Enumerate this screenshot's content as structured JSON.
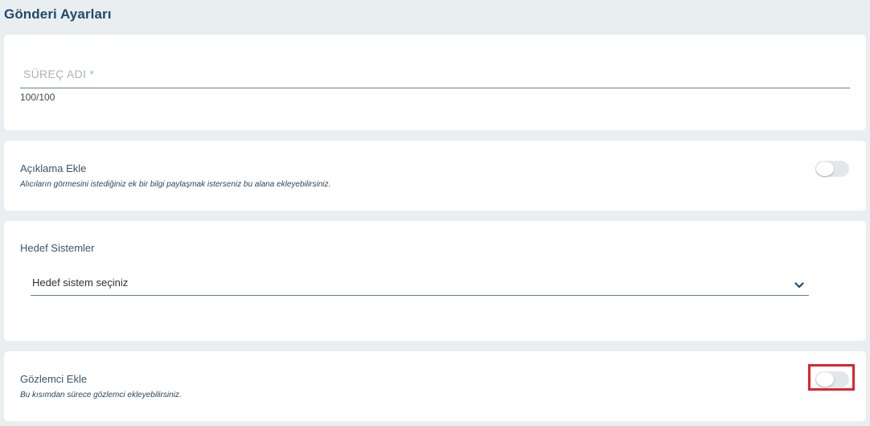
{
  "page": {
    "title": "Gönderi Ayarları"
  },
  "process_name": {
    "placeholder": "SÜREÇ ADI *",
    "value": "",
    "counter": "100/100"
  },
  "description": {
    "label": "Açıklama Ekle",
    "help": "Alıcıların görmesini istediğiniz ek bir bilgi paylaşmak isterseniz bu alana ekleyebilirsiniz.",
    "enabled": false
  },
  "target_systems": {
    "label": "Hedef Sistemler",
    "selected": "Hedef sistem seçiniz",
    "icon": "chevron-down-icon"
  },
  "observer": {
    "label": "Gözlemci Ekle",
    "help": "Bu kısımdan sürece gözlemci ekleyebilirsiniz.",
    "enabled": false,
    "highlight_color": "#d9262c"
  },
  "colors": {
    "title": "#1f4a6b",
    "background": "#e9eef1",
    "card": "#ffffff"
  }
}
